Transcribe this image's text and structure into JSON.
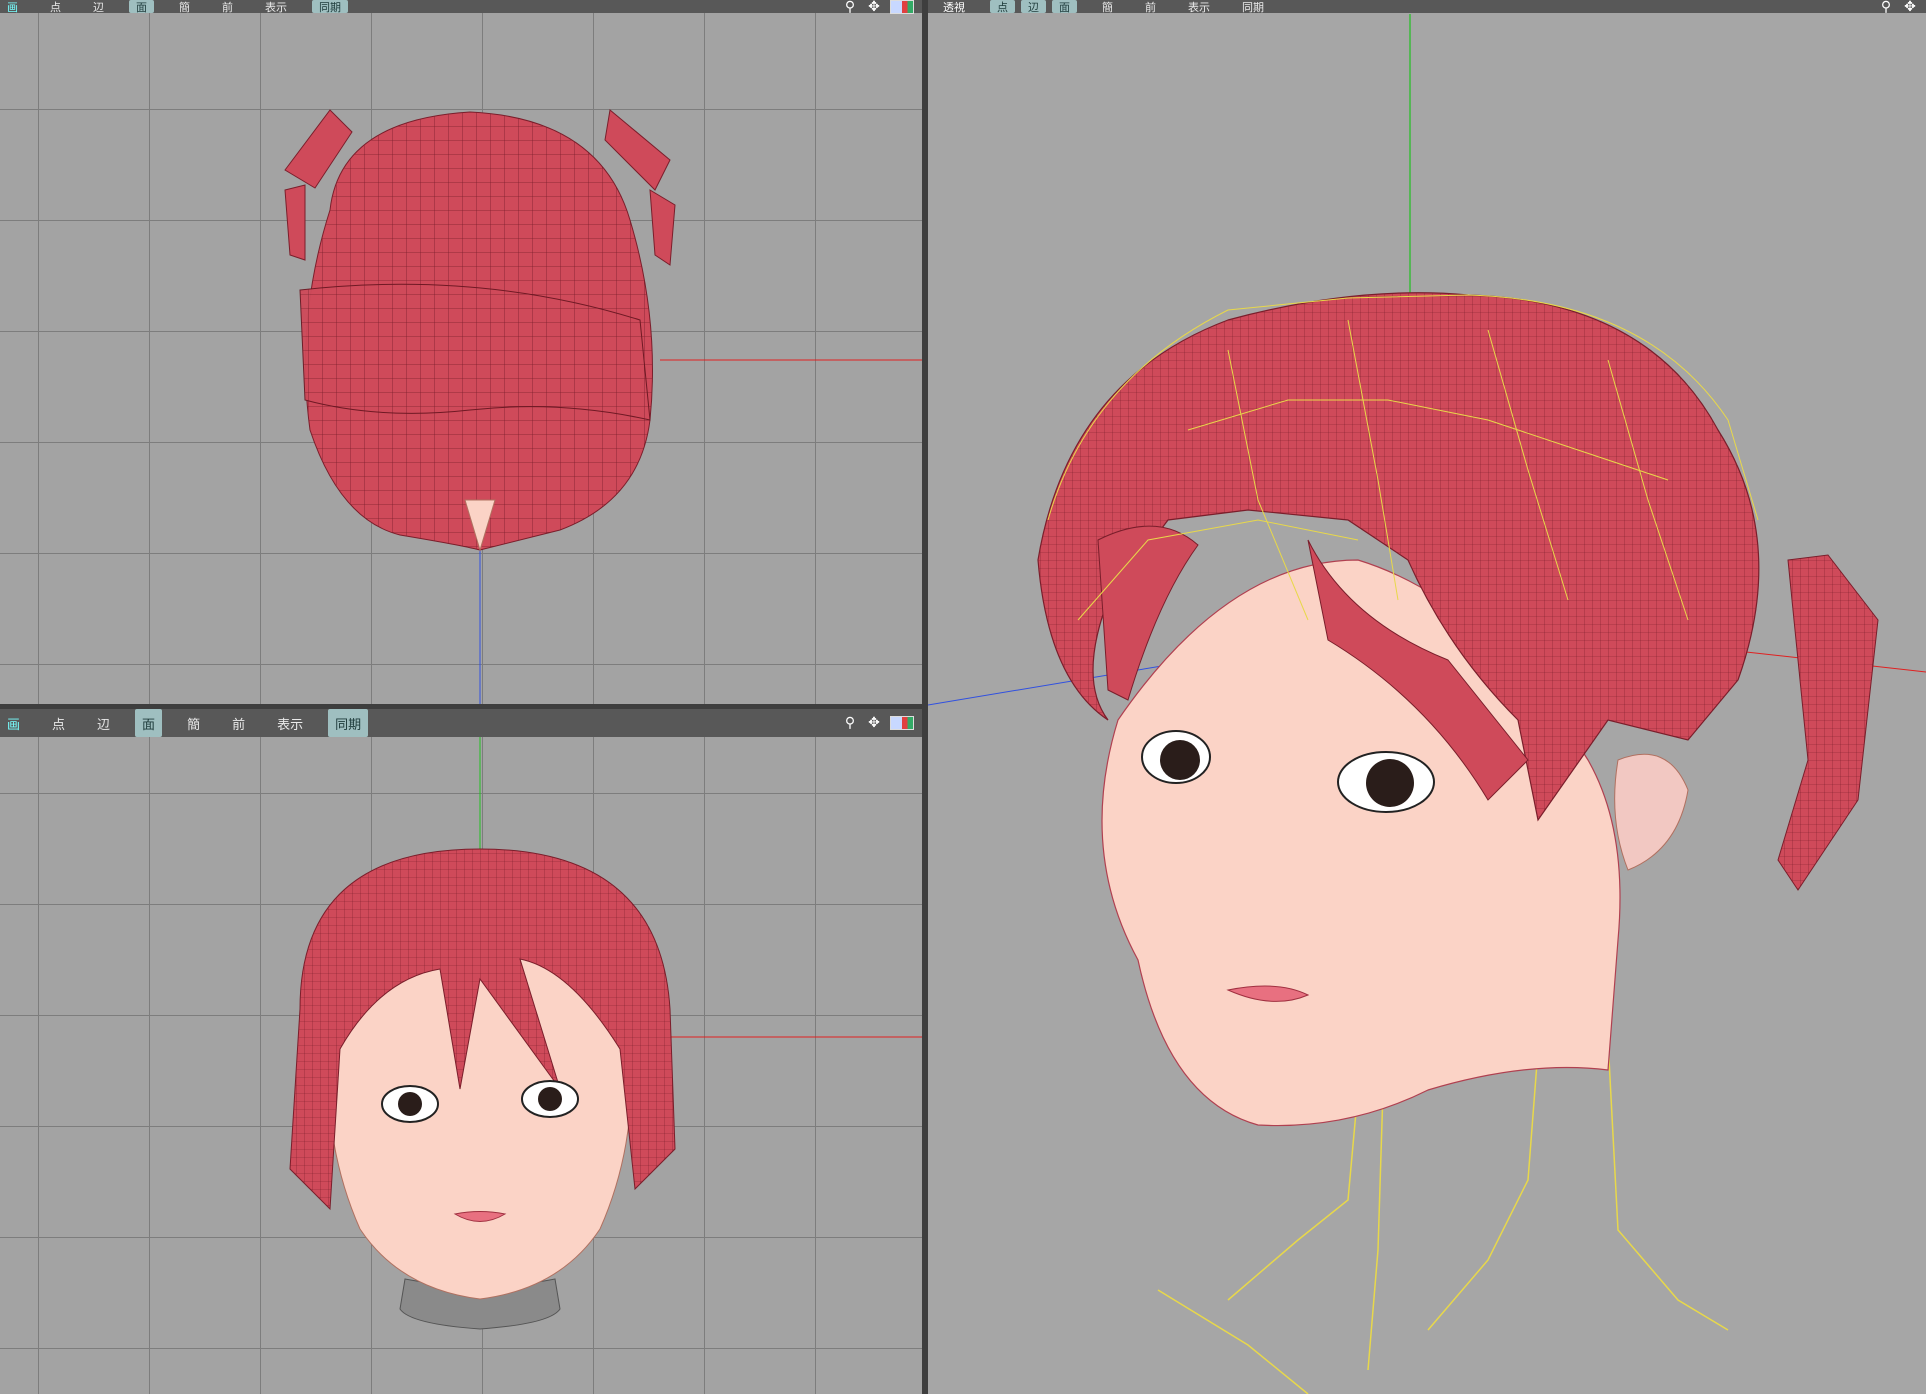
{
  "viewports": {
    "top": {
      "toolbar": {
        "view_label": "画",
        "vertex": "点",
        "edge": "辺",
        "face": "面",
        "simple": "簡",
        "front": "前",
        "display": "表示",
        "sync": "同期"
      }
    },
    "front": {
      "toolbar": {
        "view_label": "画",
        "vertex": "点",
        "edge": "辺",
        "face": "面",
        "simple": "簡",
        "front": "前",
        "display": "表示",
        "sync": "同期"
      }
    },
    "perspective": {
      "toolbar": {
        "view_label": "透視",
        "vertex": "点",
        "edge": "辺",
        "face": "面",
        "simple": "簡",
        "front": "前",
        "display": "表示",
        "sync": "同期"
      }
    }
  },
  "icons": [
    "zoom-icon",
    "move-icon",
    "screen-layout-icon"
  ],
  "colors": {
    "hair": "#cf4a5a",
    "skin": "#fbd3c6",
    "axis_x": "#e02020",
    "axis_y": "#20c020",
    "axis_z": "#3050e0",
    "bone": "#e8d84a"
  }
}
